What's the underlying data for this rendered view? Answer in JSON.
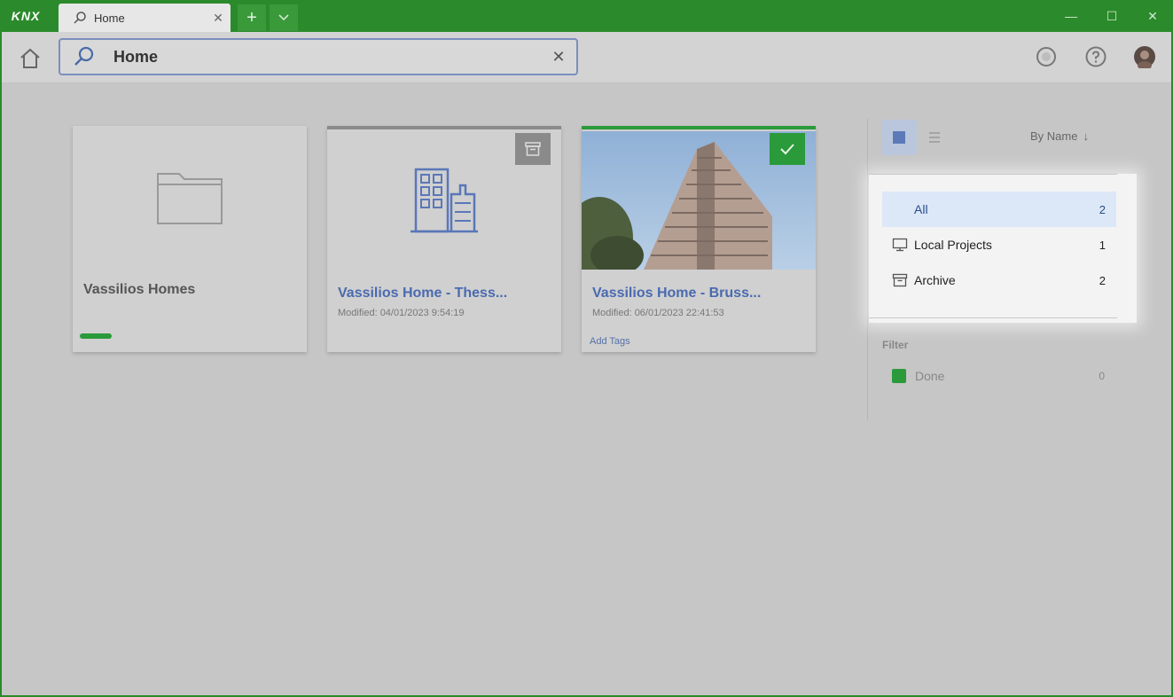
{
  "app": {
    "logo": "KNX",
    "accent": "#2b8a2b"
  },
  "tab": {
    "label": "Home",
    "close": "✕",
    "icon": "search-icon"
  },
  "titlebar": {
    "new_tab": "+",
    "minimize": "—",
    "maximize": "☐",
    "close": "✕"
  },
  "search": {
    "value": "Home",
    "clear": "✕"
  },
  "projects": [
    {
      "title": "Vassilios Homes",
      "meta": "",
      "tags": "",
      "type": "folder"
    },
    {
      "title": "Vassilios Home - Thess...",
      "meta": "Modified: 04/01/2023 9:54:19",
      "tags": "",
      "type": "building",
      "badge": "archive-icon"
    },
    {
      "title": "Vassilios Home - Bruss...",
      "meta": "Modified: 06/01/2023 22:41:53",
      "tags": "Add Tags",
      "type": "photo",
      "badge": "check-icon"
    }
  ],
  "sort": {
    "label": "By Name",
    "arrow": "↓"
  },
  "nav": [
    {
      "label": "All",
      "count": "2",
      "icon": ""
    },
    {
      "label": "Local Projects",
      "count": "1",
      "icon": "monitor-icon"
    },
    {
      "label": "Archive",
      "count": "2",
      "icon": "archive-box-icon"
    }
  ],
  "filter": {
    "heading": "Filter",
    "items": [
      {
        "label": "Done",
        "count": "0",
        "color": "#2a9a3a"
      }
    ]
  }
}
